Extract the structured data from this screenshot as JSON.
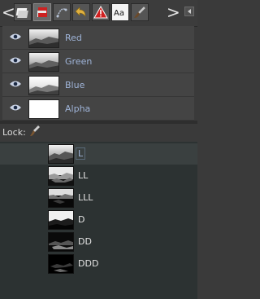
{
  "toolbar": {
    "nav_left": "<",
    "nav_right": ">",
    "tabs": [
      {
        "icon": "layers-icon"
      },
      {
        "icon": "channels-icon"
      },
      {
        "icon": "paths-icon"
      },
      {
        "icon": "undo-history-icon"
      },
      {
        "icon": "warning-icon"
      },
      {
        "icon": "text-icon",
        "text": "Aa"
      },
      {
        "icon": "brush-icon"
      }
    ],
    "menu_icon": "tab-menu-icon"
  },
  "channels": [
    {
      "label": "Red"
    },
    {
      "label": "Green"
    },
    {
      "label": "Blue"
    },
    {
      "label": "Alpha"
    }
  ],
  "lock": {
    "label": "Lock:"
  },
  "masks": [
    {
      "label": "L",
      "selected": true
    },
    {
      "label": "LL"
    },
    {
      "label": "LLL"
    },
    {
      "label": "D"
    },
    {
      "label": "DD"
    },
    {
      "label": "DDD"
    }
  ],
  "colors": {
    "label_blue": "#9fb4d8",
    "panel_bg": "#3a3a3a",
    "mask_bg": "#2c3232"
  }
}
